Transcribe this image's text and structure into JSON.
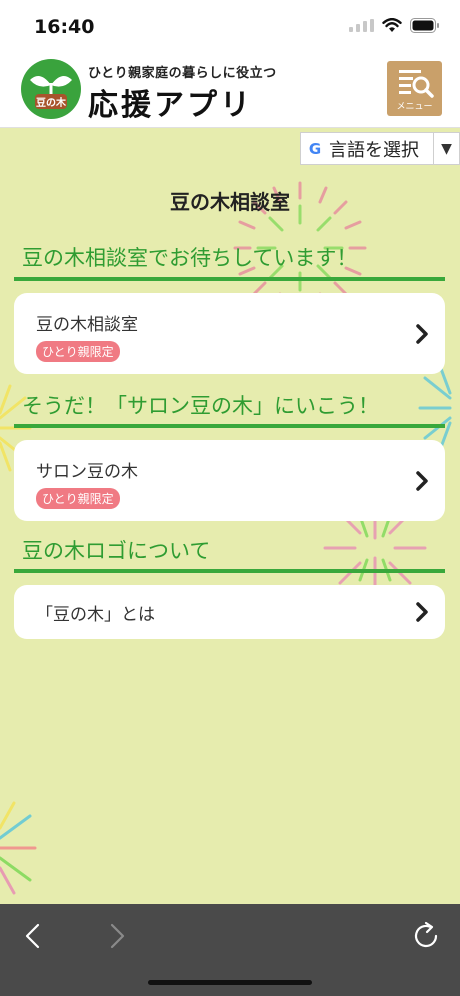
{
  "status_bar": {
    "time": "16:40"
  },
  "header": {
    "logo_text": "豆の木",
    "tagline": "ひとり親家庭の暮らしに役立つ",
    "title": "応援アプリ",
    "menu_label": "メニュー"
  },
  "language_selector": {
    "google_mark": "G",
    "label": "言語を選択",
    "caret": "▼"
  },
  "page_title": "豆の木相談室",
  "sections": [
    {
      "heading": "豆の木相談室でお待ちしています！",
      "cards": [
        {
          "title": "豆の木相談室",
          "badge": "ひとり親限定"
        }
      ]
    },
    {
      "heading": "そうだ！「サロン豆の木」にいこう！",
      "cards": [
        {
          "title": "サロン豆の木",
          "badge": "ひとり親限定"
        }
      ]
    },
    {
      "heading": "豆の木ロゴについて",
      "cards": [
        {
          "title": "「豆の木」とは"
        }
      ]
    }
  ],
  "colors": {
    "background": "#e6ecae",
    "heading_green": "#2f9c32",
    "rule_green": "#39a83b",
    "badge_pink": "#f07a83",
    "menu_tan": "#c9a06a",
    "browser_bar": "#4a4a4a"
  },
  "icons": {
    "wifi": "wifi-icon",
    "battery": "battery-icon",
    "menu": "menu-search-icon",
    "chevron": "chevron-right-icon",
    "back": "back-arrow-icon",
    "forward": "forward-arrow-icon",
    "reload": "reload-icon"
  }
}
